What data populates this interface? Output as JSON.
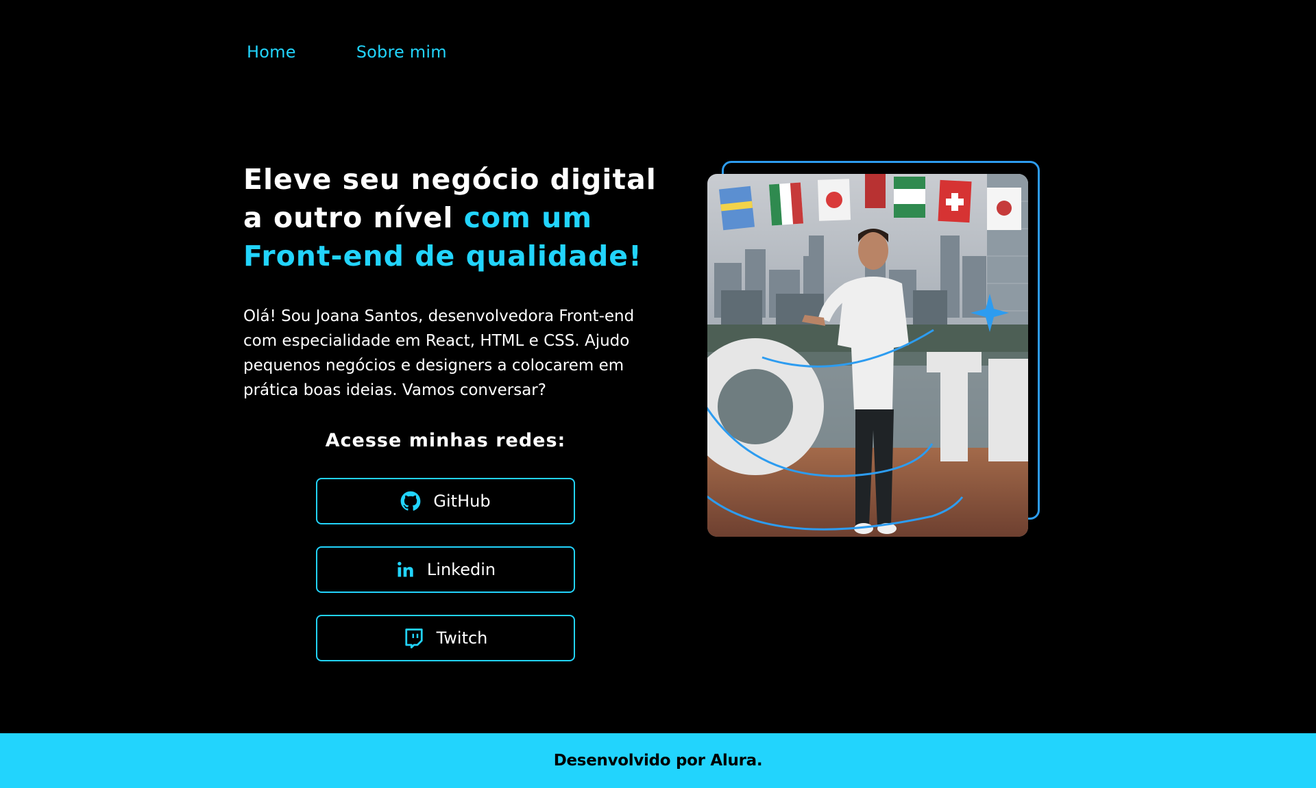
{
  "nav": {
    "items": [
      {
        "label": "Home"
      },
      {
        "label": "Sobre mim"
      }
    ]
  },
  "hero": {
    "title_part1": "Eleve seu negócio digital a outro nível ",
    "title_accent": "com um Front-end de qualidade!",
    "intro": "Olá! Sou Joana Santos, desenvolvedora Front-end com especialidade em React, HTML e CSS. Ajudo pequenos negócios e designers a colocarem em prática boas ideias. Vamos conversar?"
  },
  "social": {
    "title": "Acesse minhas redes:",
    "buttons": [
      {
        "label": "GitHub",
        "icon": "github-icon"
      },
      {
        "label": "Linkedin",
        "icon": "linkedin-icon"
      },
      {
        "label": "Twitch",
        "icon": "twitch-icon"
      }
    ]
  },
  "footer": {
    "text": "Desenvolvido por Alura."
  },
  "colors": {
    "background": "#000000",
    "accent": "#22D4FD",
    "frame": "#2D9CF0",
    "text": "#FFFFFF"
  }
}
